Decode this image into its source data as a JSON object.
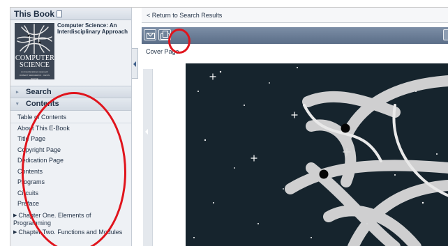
{
  "sidebar": {
    "header_title": "This Book",
    "book_title": "Computer Science: An Interdisciplinary Approach",
    "cover": {
      "title_line1": "Computer",
      "title_line2": "Science",
      "subtitle": "An Interdisciplinary Approach",
      "authors": "Robert Sedgewick · Kevin Wayne"
    },
    "sections": [
      {
        "label": "Search",
        "expanded": false
      },
      {
        "label": "Contents",
        "expanded": true
      }
    ],
    "toc": [
      "Table of Contents",
      "About This E-Book",
      "Title Page",
      "Copyright Page",
      "Dedication Page",
      "Contents",
      "Programs",
      "Circuits",
      "Preface",
      "Chapter One. Elements of Programming",
      "Chapter Two. Functions and Modules"
    ]
  },
  "main": {
    "return_link": "< Return to Search Results",
    "page_label": "Cover Page",
    "toolbar": {
      "mail_icon": "mail-icon",
      "print_icon": "print-icon"
    }
  },
  "colors": {
    "annotation": "#e0141c",
    "toolbar": "#6a7d97",
    "sidebar_bg": "#eef1f5",
    "cover_bg": "#16242d"
  }
}
